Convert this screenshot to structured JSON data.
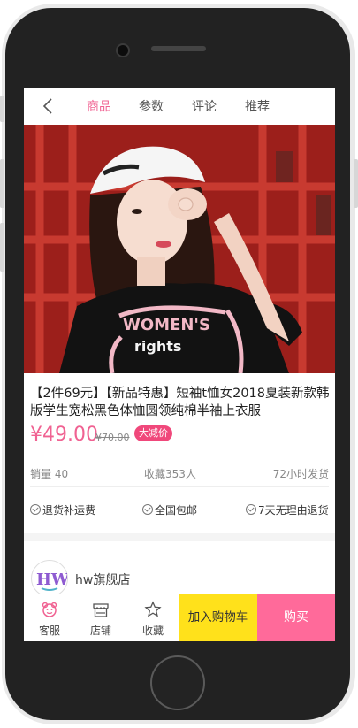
{
  "nav": {
    "tabs": [
      "商品",
      "参数",
      "评论",
      "推荐"
    ],
    "active_tab": "商品"
  },
  "product": {
    "title": "【2件69元】【新品特惠】短袖t恤女2018夏装新款韩版学生宽松黑色体恤圆领纯棉半袖上衣服",
    "price": "¥49.00",
    "original_price": "¥70.00",
    "badge": "大减价",
    "shirt_text_1": "WOMEN'S",
    "shirt_text_2": "rights"
  },
  "stats": {
    "sales": "销量 40",
    "favorites": "收藏353人",
    "shipping": "72小时发货"
  },
  "guarantees": [
    "退货补运费",
    "全国包邮",
    "7天无理由退货"
  ],
  "store": {
    "logo_text": "HW",
    "name": "hw旗舰店"
  },
  "bottom_bar": {
    "service_label": "客服",
    "shop_label": "店铺",
    "favorite_label": "收藏",
    "add_to_cart_label": "加入购物车",
    "buy_label": "购买"
  },
  "colors": {
    "accent": "#f06292",
    "cart_button": "#ffe11b",
    "buy_button": "#ff6a9a",
    "badge": "#f0487b"
  }
}
